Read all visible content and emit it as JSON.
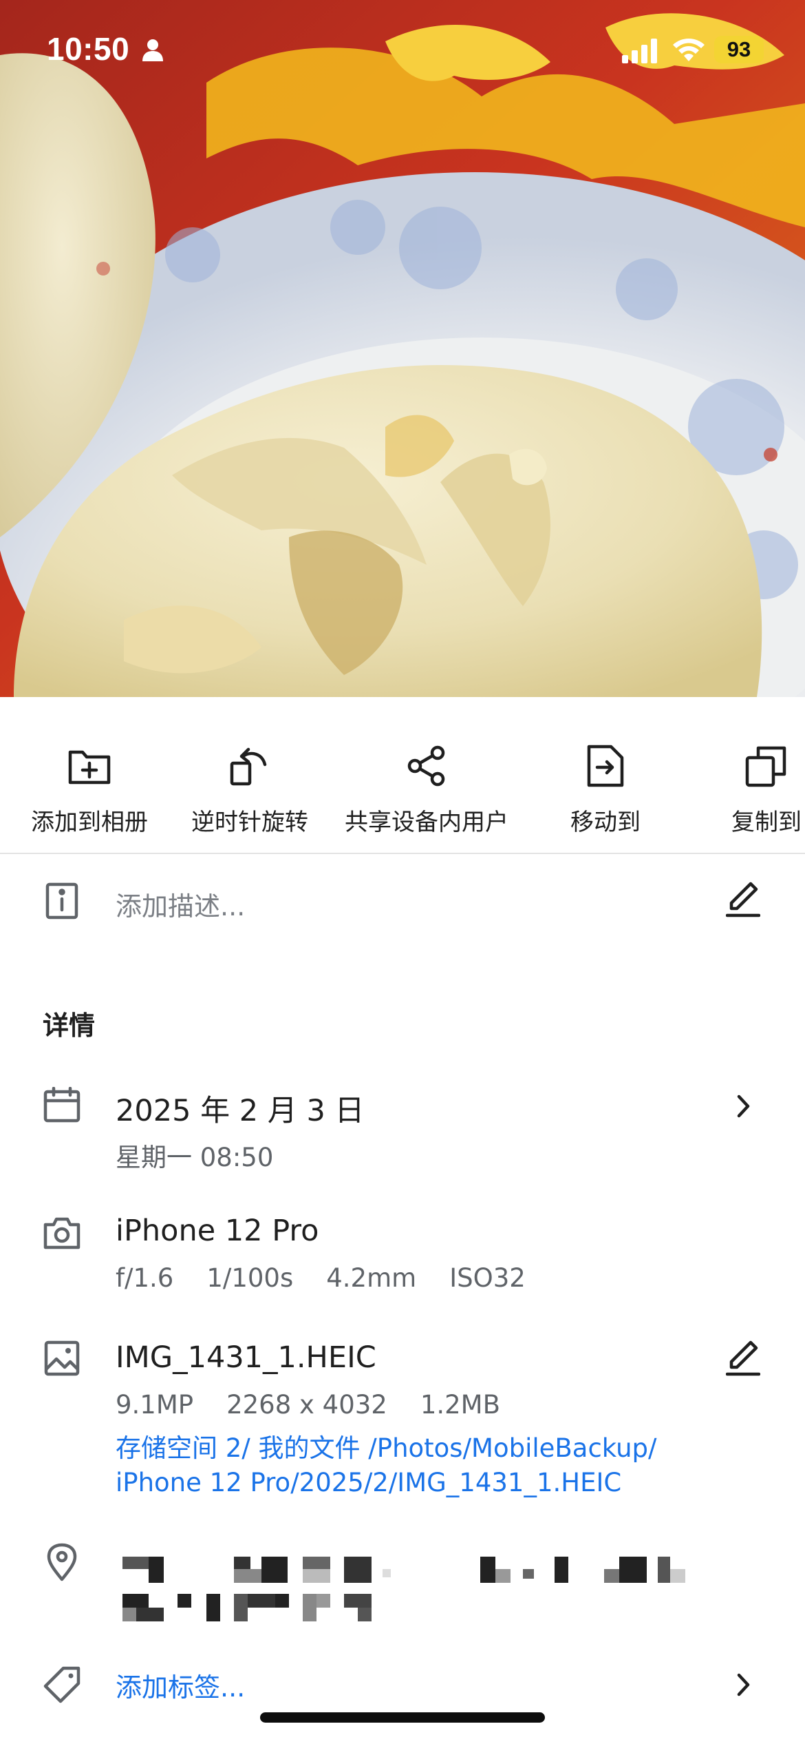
{
  "status_bar": {
    "time": "10:50",
    "battery": "93"
  },
  "actions": [
    {
      "label": "添加到相册",
      "icon": "folder-add-icon"
    },
    {
      "label": "逆时针旋转",
      "icon": "rotate-left-icon"
    },
    {
      "label": "共享设备内用户",
      "icon": "share-icon"
    },
    {
      "label": "移动到",
      "icon": "move-file-icon"
    },
    {
      "label": "复制到",
      "icon": "copy-icon"
    }
  ],
  "description": {
    "placeholder": "添加描述..."
  },
  "details": {
    "heading": "详情",
    "date": {
      "primary": "2025 年 2 月 3 日",
      "secondary": "星期一  08:50"
    },
    "camera": {
      "model": "iPhone 12 Pro",
      "aperture": "f/1.6",
      "shutter": "1/100s",
      "focal": "4.2mm",
      "iso": "ISO32"
    },
    "file": {
      "name": "IMG_1431_1.HEIC",
      "megapixels": "9.1MP",
      "resolution": "2268 x 4032",
      "size": "1.2MB",
      "path": "存储空间 2/ 我的文件 /Photos/MobileBackup/ iPhone 12 Pro/2025/2/IMG_1431_1.HEIC"
    },
    "tags": {
      "placeholder": "添加标签..."
    }
  },
  "colors": {
    "link": "#1a73e8",
    "battery": "#f3d433",
    "secondary_text": "#5f6368"
  }
}
